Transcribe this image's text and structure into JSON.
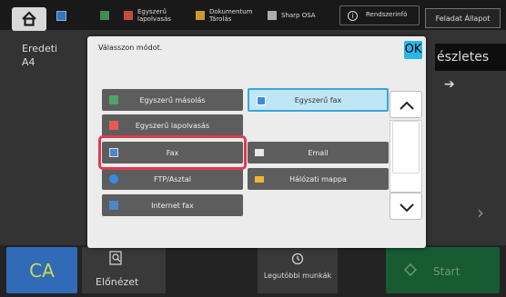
{
  "topbar": {
    "items": [
      {
        "label": "Egyszerű lapolvasás",
        "color": "#e85a4f"
      },
      {
        "label": "Dokumentum Tárolás",
        "color": "#f0b53a"
      },
      {
        "label": "Sharp OSA",
        "color": "#cccccc"
      }
    ],
    "system_info": "Rendszerinfó",
    "job_status": "Feladat Állapot"
  },
  "background": {
    "original_label": "Eredeti",
    "original_value": "A4",
    "detail_label": "észletes"
  },
  "dialog": {
    "title": "Válasszon módot.",
    "ok": "OK",
    "options": [
      {
        "label": "Egyszerű másolás",
        "icon": "copy-icon",
        "selected": false
      },
      {
        "label": "Egyszerű fax",
        "icon": "fax-icon",
        "selected": true
      },
      {
        "label": "Egyszerű lapolvasás",
        "icon": "scan-icon",
        "selected": false
      },
      {
        "label": "Fax",
        "icon": "fax-icon",
        "selected": false
      },
      {
        "label": "Email",
        "icon": "email-icon",
        "selected": false
      },
      {
        "label": "FTP/Asztal",
        "icon": "ftp-icon",
        "selected": false
      },
      {
        "label": "Hálózati mappa",
        "icon": "folder-icon",
        "selected": false
      },
      {
        "label": "Internet fax",
        "icon": "internet-fax-icon",
        "selected": false
      }
    ]
  },
  "bottom": {
    "ca": "CA",
    "preview": "Előnézet",
    "recent": "Legutóbbi munkák",
    "start": "Start"
  }
}
